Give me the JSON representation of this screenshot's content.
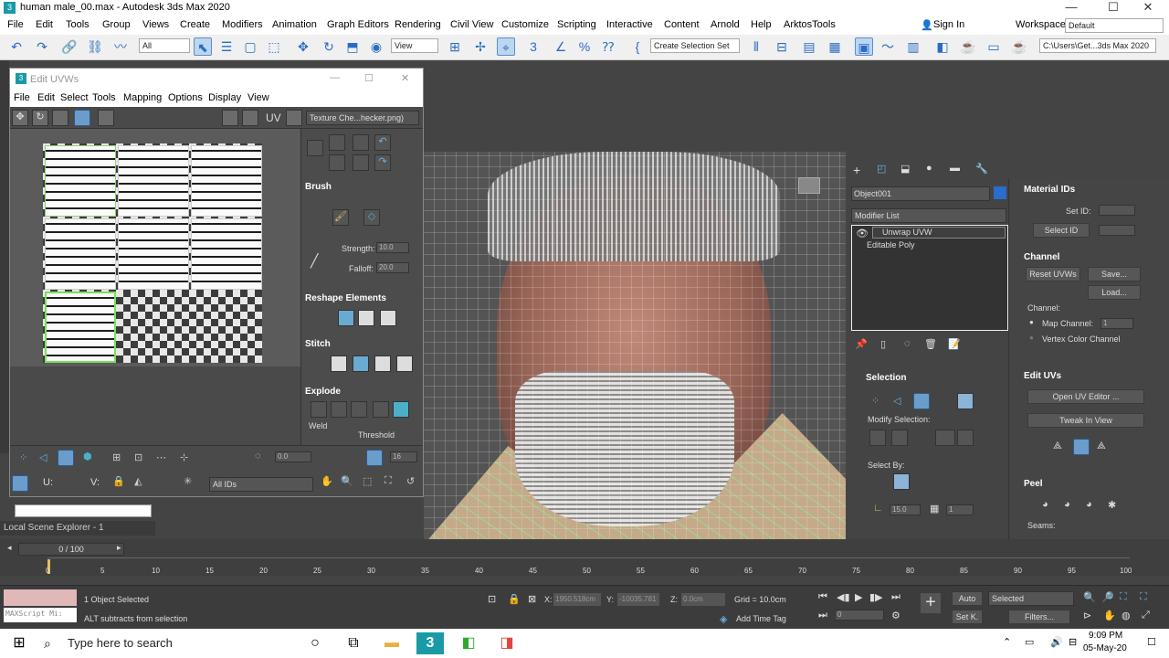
{
  "window": {
    "title": "human male_00.max - Autodesk 3ds Max 2020"
  },
  "menu": [
    "File",
    "Edit",
    "Tools",
    "Group",
    "Views",
    "Create",
    "Modifiers",
    "Animation",
    "Graph Editors",
    "Rendering",
    "Civil View",
    "Customize",
    "Scripting",
    "Interactive",
    "Content",
    "Arnold",
    "Help",
    "ArktosTools"
  ],
  "signin": "Sign In",
  "workspaces_label": "Workspaces:",
  "workspaces_value": "Default",
  "toolbar": {
    "filter": "All",
    "view": "View",
    "selection_set": "Create Selection Set",
    "path": "C:\\Users\\Get...3ds Max 2020"
  },
  "uvw": {
    "title": "Edit UVWs",
    "menu": [
      "File",
      "Edit",
      "Select",
      "Tools",
      "Mapping",
      "Options",
      "Display",
      "View"
    ],
    "uv_label": "UV",
    "texture": "Texture Che...hecker.png)",
    "brush": "Brush",
    "strength_label": "Strength:",
    "strength": "10.0",
    "falloff_label": "Falloff:",
    "falloff": "20.0",
    "reshape": "Reshape Elements",
    "stitch": "Stitch",
    "explode": "Explode",
    "weld": "Weld",
    "threshold": "Threshold",
    "u_label": "U:",
    "v_label": "V:",
    "spin1": "0.0",
    "spin2": "16",
    "ids": "All IDs"
  },
  "scene_explorer": "Local Scene Explorer - 1",
  "command": {
    "object": "Object001",
    "modifier_list": "Modifier List",
    "stack": [
      "Unwrap UVW",
      "Editable Poly"
    ],
    "selection": "Selection",
    "modify_selection": "Modify Selection:",
    "select_by": "Select By:",
    "angle": "15.0",
    "count": "1"
  },
  "rollout": {
    "material_ids": "Material IDs",
    "set_id": "Set ID:",
    "select_id": "Select ID",
    "channel": "Channel",
    "reset_uvws": "Reset UVWs",
    "save": "Save...",
    "load": "Load...",
    "channel_label": "Channel:",
    "map_channel": "Map Channel:",
    "map_channel_value": "1",
    "vertex_color": "Vertex Color Channel",
    "edit_uvs": "Edit UVs",
    "open_uv_editor": "Open UV Editor ...",
    "tweak": "Tweak In View",
    "peel": "Peel",
    "seams": "Seams:"
  },
  "timeline": {
    "frame": "0 / 100",
    "ticks": [
      "0",
      "5",
      "10",
      "15",
      "20",
      "25",
      "30",
      "35",
      "40",
      "45",
      "50",
      "55",
      "60",
      "65",
      "70",
      "75",
      "80",
      "85",
      "90",
      "95",
      "100"
    ]
  },
  "status": {
    "maxscript": "MAXScript Mi:",
    "selected": "1 Object Selected",
    "hint": "ALT subtracts from selection",
    "x_label": "X:",
    "x": "1950.518cm",
    "y_label": "Y:",
    "y": "-10035.781",
    "z_label": "Z:",
    "z": "0.0cm",
    "grid": "Grid = 10.0cm",
    "add_time_tag": "Add Time Tag",
    "auto": "Auto",
    "selected_dd": "Selected",
    "setk": "Set K.",
    "filters": "Filters...",
    "frame_field": "0"
  },
  "taskbar": {
    "search": "Type here to search",
    "time": "9:09 PM",
    "date": "05-May-20"
  }
}
